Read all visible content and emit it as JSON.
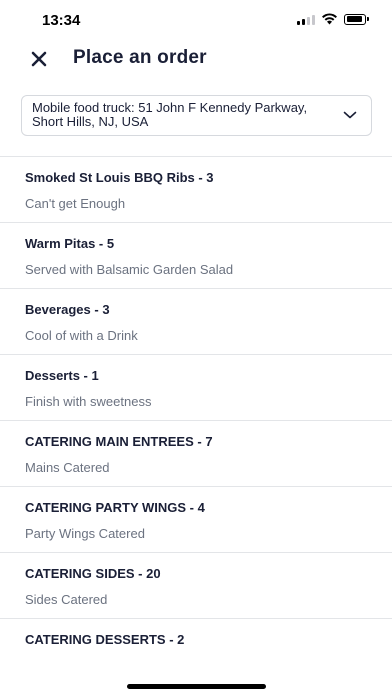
{
  "status_bar": {
    "time": "13:34",
    "icons": [
      "cellular-signal-icon",
      "wifi-icon",
      "battery-icon"
    ]
  },
  "header": {
    "title": "Place an order",
    "close_icon": "close-icon"
  },
  "location": {
    "value": "Mobile food truck: 51 John F Kennedy Parkway, Short Hills, NJ, USA",
    "icon": "chevron-down-icon"
  },
  "menu": [
    {
      "title": "Smoked St Louis BBQ Ribs - 3",
      "subtitle": "Can't get Enough"
    },
    {
      "title": "Warm Pitas - 5",
      "subtitle": "Served with Balsamic Garden Salad"
    },
    {
      "title": "Beverages - 3",
      "subtitle": "Cool of with a Drink"
    },
    {
      "title": "Desserts - 1",
      "subtitle": "Finish with sweetness"
    },
    {
      "title": "CATERING MAIN ENTREES - 7",
      "subtitle": "Mains Catered"
    },
    {
      "title": "CATERING PARTY WINGS - 4",
      "subtitle": "Party Wings Catered"
    },
    {
      "title": "CATERING SIDES - 20",
      "subtitle": "Sides Catered"
    },
    {
      "title": "CATERING DESSERTS - 2",
      "subtitle": ""
    }
  ],
  "colors": {
    "text": "#1a1f36",
    "subtext": "#6b7280",
    "divider": "#e3e5e8",
    "border": "#d6d9de"
  }
}
